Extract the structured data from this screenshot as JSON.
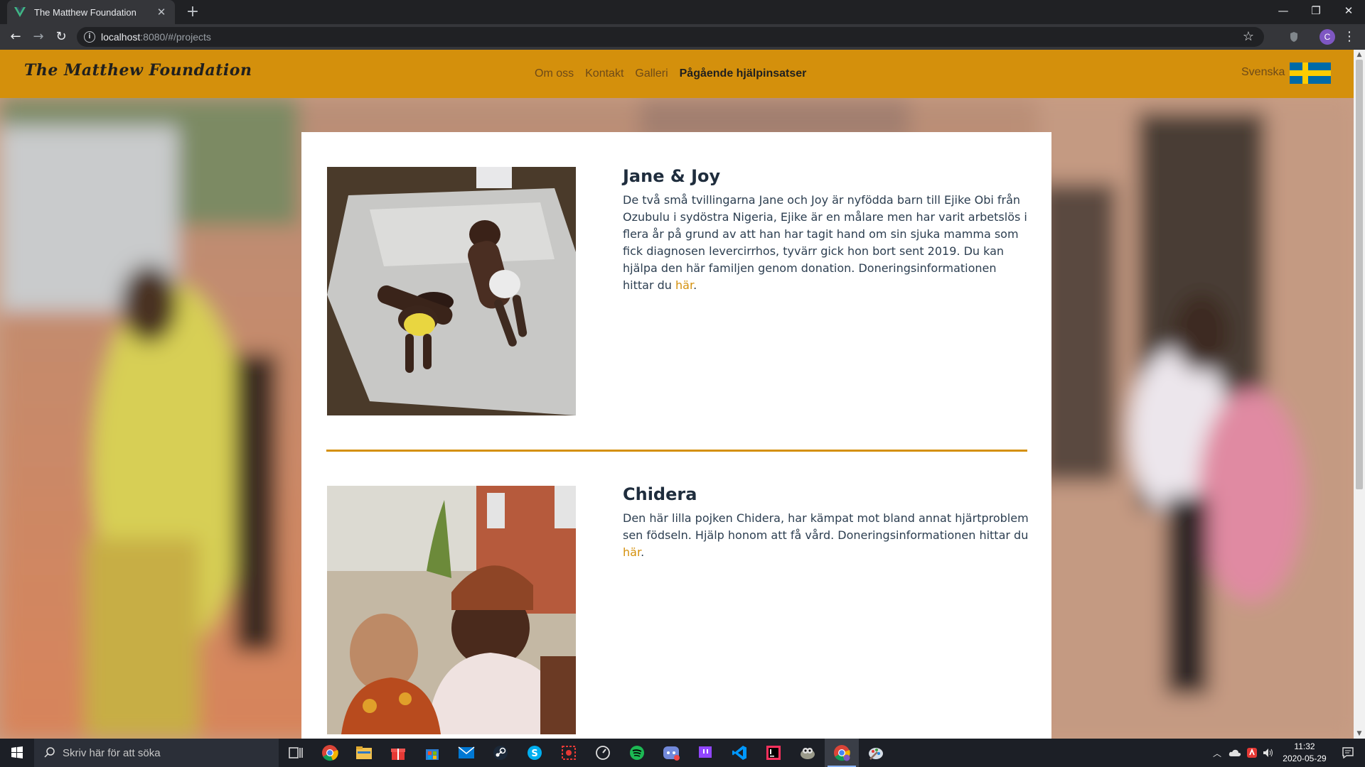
{
  "browser": {
    "tab_title": "The Matthew Foundation",
    "tab_close": "✕",
    "new_tab": "+",
    "url_host": "localhost",
    "url_rest": ":8080/#/projects",
    "back": "←",
    "forward": "→",
    "reload": "↻",
    "bookmark": "☆",
    "profile_initial": "C",
    "menu": "⋮",
    "window_minimize": "—",
    "window_restore": "❐",
    "window_close": "✕"
  },
  "site": {
    "brand": "The Matthew Foundation",
    "nav": [
      "Om oss",
      "Kontakt",
      "Galleri",
      "Pågående hjälpinsatser"
    ],
    "active_nav": "Pågående hjälpinsatser",
    "language": "Svenska",
    "accent_color": "#d4900c"
  },
  "projects": [
    {
      "title": "Jane & Joy",
      "text": "De två små tvillingarna Jane och Joy är nyfödda barn till Ejike Obi från Ozubulu i sydöstra Nigeria, Ejike är en målare men har varit arbetslös i flera år på grund av att han har tagit hand om sin sjuka mamma som fick diagnosen levercirrhos, tyvärr gick hon bort sent 2019. Du kan hjälpa den här familjen genom donation. Doneringsinformationen hittar du",
      "link": "här",
      "end": "."
    },
    {
      "title": "Chidera",
      "text": "Den här lilla pojken Chidera, har kämpat mot bland annat hjärtproblem sen födseln. Hjälp honom att få vård. Doneringsinformationen hittar du",
      "link": "här",
      "end": "."
    }
  ],
  "taskbar": {
    "search_placeholder": "Skriv här för att söka",
    "time": "11:32",
    "date": "2020-05-29",
    "apps": [
      "task-view",
      "chrome",
      "file-explorer",
      "gift",
      "store",
      "mail",
      "steam",
      "skype",
      "sniping",
      "speedometer",
      "spotify",
      "discord",
      "twitch",
      "vscode",
      "intellij",
      "gimp",
      "chrome-active",
      "paint"
    ]
  }
}
